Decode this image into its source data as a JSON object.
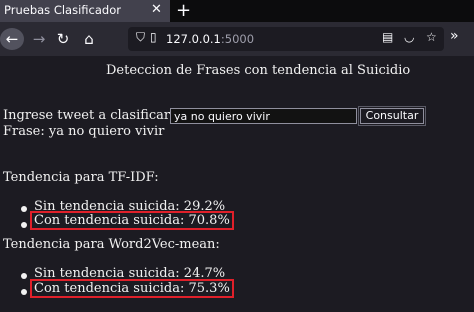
{
  "browser": {
    "tab_title": "Pruebas Clasificador",
    "tab_close": "✕",
    "new_tab": "+",
    "url_host": "127.0.0.1",
    "url_port": ":5000",
    "icons": [
      "back-icon",
      "forward-icon",
      "reload-icon",
      "home-icon",
      "shield-icon",
      "page-icon",
      "reader-icon",
      "pocket-icon",
      "bookmark-star-icon",
      "overflow-icon"
    ]
  },
  "page": {
    "heading": "Deteccion de Frases con tendencia al Suicidio",
    "input_label": "Ingrese tweet a clasificar:",
    "input_value": "ya no quiero vivir",
    "submit_label": "Consultar",
    "frase": "Frase: ya no quiero vivir",
    "tfidf": {
      "title": "Tendencia para TF-IDF:",
      "items": [
        "Sin tendencia suicida: 29.2%",
        "Con tendencia suicida: 70.8%"
      ]
    },
    "w2v": {
      "title": "Tendencia para Word2Vec-mean:",
      "items": [
        "Sin tendencia suicida: 24.7%",
        "Con tendencia suicida: 75.3%"
      ]
    },
    "highlight_color": "#e0202a"
  }
}
